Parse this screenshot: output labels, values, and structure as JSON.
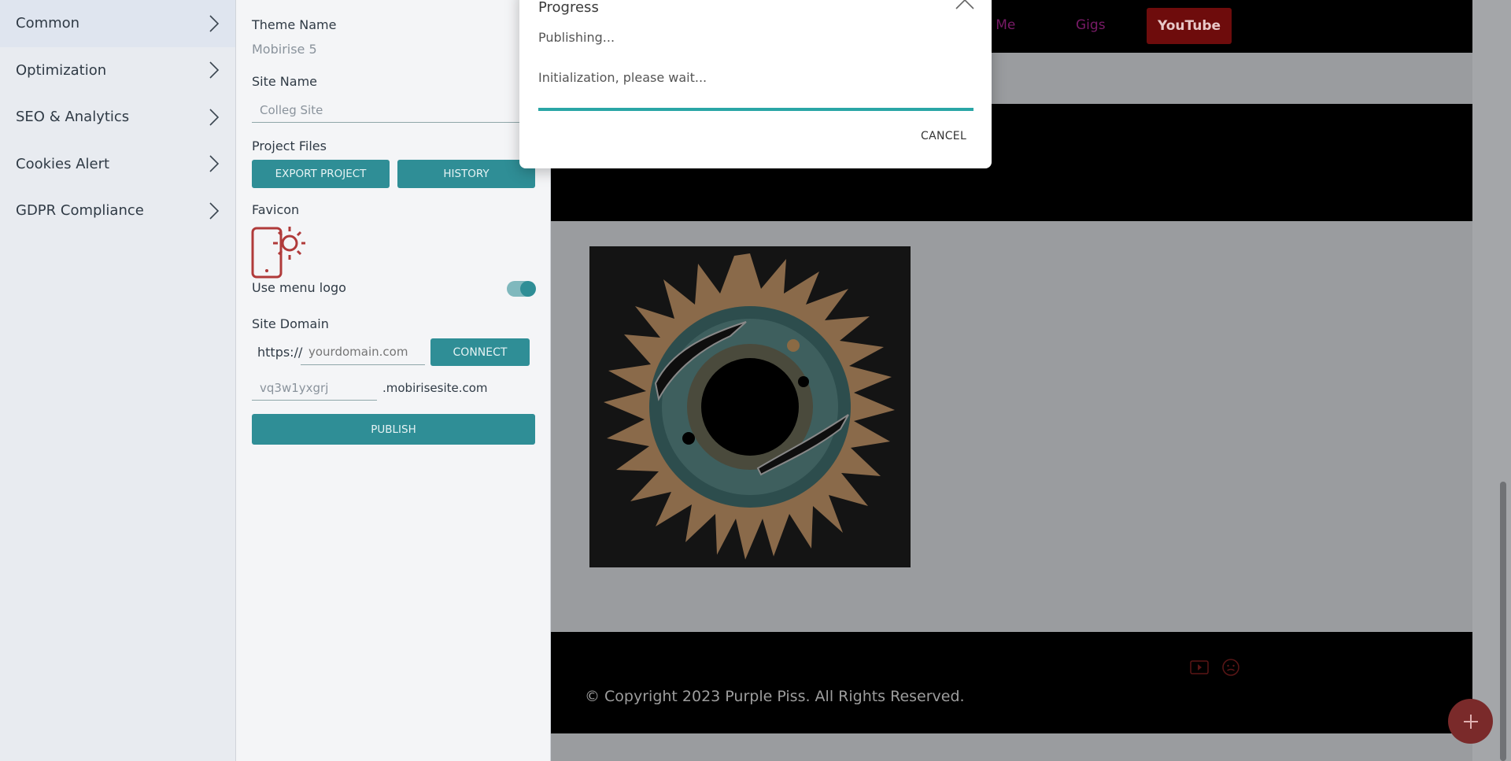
{
  "sidebar": {
    "items": [
      {
        "label": "Common"
      },
      {
        "label": "Optimization"
      },
      {
        "label": "SEO & Analytics"
      },
      {
        "label": "Cookies Alert"
      },
      {
        "label": "GDPR Compliance"
      }
    ]
  },
  "settings": {
    "theme_name_label": "Theme Name",
    "theme_name_value": "Mobirise 5",
    "site_name_label": "Site Name",
    "site_name_value": "Colleg Site",
    "project_files_label": "Project Files",
    "export_button": "EXPORT PROJECT",
    "history_button": "HISTORY",
    "favicon_label": "Favicon",
    "use_menu_logo_label": "Use menu logo",
    "use_menu_logo_on": true,
    "site_domain_label": "Site Domain",
    "domain_prefix": "https://",
    "domain_placeholder": "yourdomain.com",
    "connect_button": "CONNECT",
    "subdomain_value": "vq3w1yxgrj",
    "subdomain_suffix": ".mobirisesite.com",
    "publish_button": "PUBLISH"
  },
  "preview": {
    "nav_about": "out Me",
    "nav_gigs": "Gigs",
    "nav_youtube": "YouTube",
    "footer_copyright": "© Copyright 2023 Purple Piss. All Rights Reserved."
  },
  "dialog": {
    "title": "Progress",
    "status": "Publishing...",
    "message": "Initialization, please wait...",
    "cancel_button": "CANCEL"
  }
}
